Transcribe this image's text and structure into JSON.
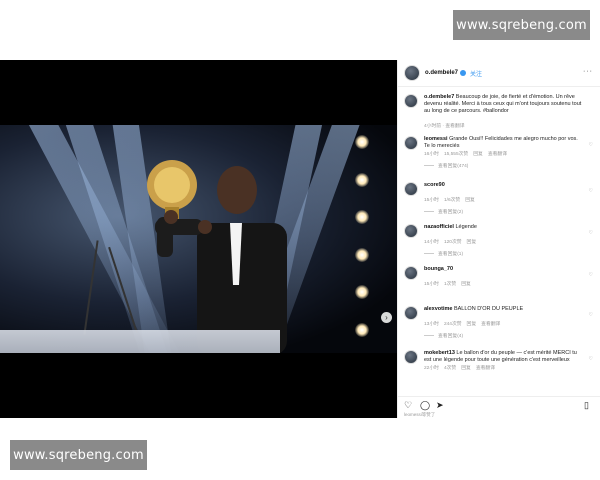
{
  "watermarks": {
    "top": "www.sqrebeng.com",
    "bottom": "www.sqrebeng.com"
  },
  "post": {
    "username": "o.dembele7",
    "follow_label": "关注",
    "caption_user": "o.dembele7",
    "caption": "Beaucoup de joie, de fierté et d'émotion. Un rêve devenu réalité. Merci à tous ceux qui m'ont toujours soutenu tout au long de ce parcours. #ballondor",
    "caption_meta": "4小时前 · 查看翻译"
  },
  "comments": [
    {
      "user": "leomessi",
      "text": "Grande Ousi!! Felicidades me alegro mucho por vos. Te lo mereciés",
      "time": "16小时",
      "likes": "15,555次赞",
      "reply": "回复",
      "translate": "查看翻译",
      "replies": "查看回复(474)"
    },
    {
      "user": "score90",
      "text": "",
      "time": "15小时",
      "likes": "1/6次赞",
      "reply": "回复",
      "translate": "",
      "replies": "查看回复(2)"
    },
    {
      "user": "nazaofficiel",
      "text": "Légende",
      "time": "14小时",
      "likes": "120次赞",
      "reply": "回复",
      "translate": "",
      "replies": "查看回复(1)"
    },
    {
      "user": "bounga_70",
      "text": "",
      "time": "15小时",
      "likes": "1次赞",
      "reply": "回复",
      "translate": "",
      "replies": ""
    },
    {
      "user": "alexvotime",
      "text": "BALLON D'OR DU PEUPLE",
      "time": "13小时",
      "likes": "244次赞",
      "reply": "回复",
      "translate": "查看翻译",
      "replies": "查看回复(4)"
    },
    {
      "user": "mokebert13",
      "text": "Le ballon d'or du peuple — c'est mérité MERCI tu est une légende pour toute une génération c'est merveilleux",
      "time": "22小时",
      "likes": "4次赞",
      "reply": "回复",
      "translate": "查看翻译",
      "replies": ""
    }
  ],
  "footer": {
    "liked_by": "leomessi等赞了"
  },
  "icons": {
    "like": "heart-icon",
    "comment": "comment-icon",
    "share": "share-icon",
    "save": "bookmark-icon",
    "more": "more-icon",
    "next": "chevron-right-icon"
  },
  "colors": {
    "accent": "#3897f0"
  }
}
